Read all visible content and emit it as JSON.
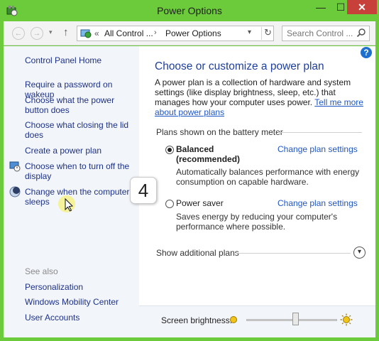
{
  "window": {
    "title": "Power Options",
    "controls": {
      "minimize": "—",
      "maximize": "☐",
      "close": "✕"
    }
  },
  "address_bar": {
    "prefix": "«",
    "crumbs": [
      "All Control ...",
      "Power Options"
    ],
    "separator": "›"
  },
  "search": {
    "placeholder": "Search Control ..."
  },
  "sidebar": {
    "home": "Control Panel Home",
    "items": [
      "Require a password on wakeup",
      "Choose what the power button does",
      "Choose what closing the lid does",
      "Create a power plan",
      "Choose when to turn off the display",
      "Change when the computer sleeps"
    ],
    "see_also_label": "See also",
    "see_also": [
      "Personalization",
      "Windows Mobility Center",
      "User Accounts"
    ]
  },
  "main": {
    "title": "Choose or customize a power plan",
    "intro": "A power plan is a collection of hardware and system settings (like display brightness, sleep, etc.) that manages how your computer uses power.",
    "intro_link": "Tell me more about power plans",
    "group_label": "Plans shown on the battery meter",
    "plans": [
      {
        "name": "Balanced",
        "tag": "(recommended)",
        "selected": true,
        "description": "Automatically balances performance with energy consumption on capable hardware.",
        "link": "Change plan settings"
      },
      {
        "name": "Power saver",
        "tag": "",
        "selected": false,
        "description": "Saves energy by reducing your computer's performance where possible.",
        "link": "Change plan settings"
      }
    ],
    "show_more": "Show additional plans"
  },
  "brightness": {
    "label": "Screen brightness:",
    "level_percent": 55
  },
  "callout": {
    "step": "4"
  },
  "colors": {
    "window_frame": "#6ccb3a",
    "close_button": "#c7403a",
    "link_blue": "#1e3287",
    "title_blue": "#1f3f9e",
    "pane_bg": "#f2f5fa"
  }
}
